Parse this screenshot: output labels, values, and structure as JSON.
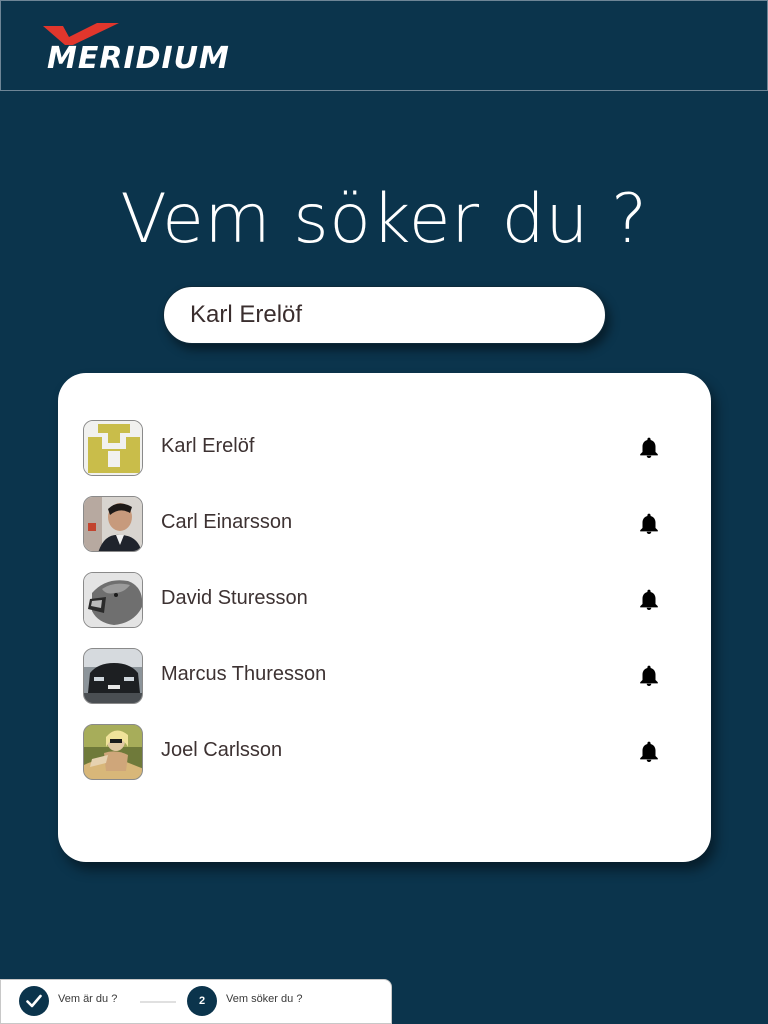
{
  "header": {
    "logo_text": "MERIDIUM",
    "logo_mark_color": "#e1362c"
  },
  "title": "Vem söker du ?",
  "search": {
    "value": "Karl Erelöf",
    "placeholder": ""
  },
  "results": [
    {
      "name": "Karl Erelöf",
      "avatar": "yellow-pixel-avatar",
      "action_icon": "bell-icon"
    },
    {
      "name": "Carl Einarsson",
      "avatar": "man-portrait-photo",
      "action_icon": "bell-icon"
    },
    {
      "name": "David Sturesson",
      "avatar": "lion-roaring-photo",
      "action_icon": "bell-icon"
    },
    {
      "name": "Marcus Thuresson",
      "avatar": "car-photo",
      "action_icon": "bell-icon"
    },
    {
      "name": "Joel Carlsson",
      "avatar": "woman-sunglasses-photo",
      "action_icon": "bell-icon"
    }
  ],
  "stepper": {
    "steps": [
      {
        "label": "Vem är du ?",
        "state": "completed",
        "marker": "check-icon"
      },
      {
        "label": "Vem söker du ?",
        "state": "current",
        "marker": "2"
      }
    ]
  },
  "colors": {
    "background": "#0b344c",
    "card": "#ffffff",
    "accent": "#e1362c",
    "text": "#3d3232"
  }
}
